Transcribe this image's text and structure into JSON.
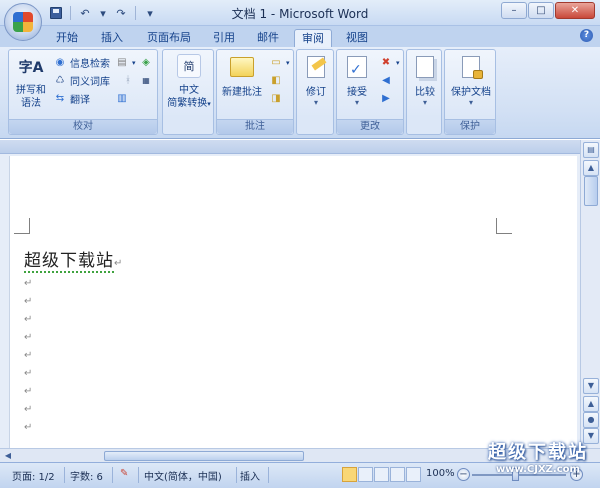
{
  "titlebar": {
    "title": "文档 1 - Microsoft Word",
    "qat": {
      "undo_glyph": "↶",
      "redo_glyph": "↷",
      "customize_glyph": "▾",
      "dropdown_glyph": "▾"
    },
    "window": {
      "minimize": "–",
      "maximize": "□",
      "close": "✕"
    }
  },
  "tabs": {
    "items": [
      "开始",
      "插入",
      "页面布局",
      "引用",
      "邮件",
      "审阅",
      "视图"
    ],
    "active": "审阅",
    "help": "?"
  },
  "ribbon": {
    "proofing": {
      "label": "校对",
      "spelling": {
        "icon_text": "字A",
        "line1": "拼写和",
        "line2": "语法"
      },
      "research": "信息检索",
      "thesaurus": "同义词库",
      "translate": "翻译"
    },
    "chinese": {
      "label_line1": "中文",
      "label_line2": "简繁转换",
      "icon_text": "简",
      "arrow": "▾"
    },
    "comments": {
      "label": "批注",
      "new_comment": "新建批注"
    },
    "tracking": {
      "label": "修订",
      "arrow": "▾"
    },
    "changes": {
      "label": "更改",
      "accept": "接受",
      "arrow": "▾"
    },
    "compare": {
      "label": "比较",
      "arrow": "▾"
    },
    "protect": {
      "label": "保护",
      "protect_doc": "保护文档",
      "arrow": "▾"
    }
  },
  "document": {
    "heading_text": "超级下载站",
    "para_mark": "↵",
    "empty_paragraphs": 9
  },
  "statusbar": {
    "page": "页面: 1/2",
    "words": "字数: 6",
    "language": "中文(简体，中国)",
    "mode": "插入",
    "zoom": "100%",
    "zoom_out": "−",
    "zoom_in": "+"
  },
  "watermark": {
    "main": "超级下载站",
    "url": "www.CJXZ.com"
  },
  "colors": {
    "ribbon_bg": "#dce7f7",
    "tab_text": "#15428b",
    "close_button": "#c9483a",
    "active_view": "#f9d776"
  }
}
